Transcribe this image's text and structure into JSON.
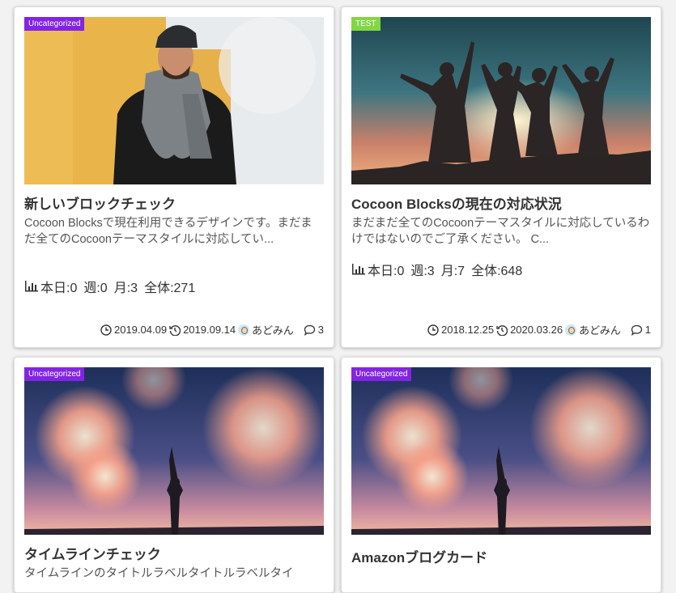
{
  "cards": [
    {
      "category": "Uncategorized",
      "category_color": "#8224e3",
      "title": "新しいブロックチェック",
      "snippet": "Cocoon Blocksで現在利用できるデザインです。まだまだ全てのCocoonテーマスタイルに対応してい...",
      "pv": {
        "today": "本日:0",
        "week": "週:0",
        "month": "月:3",
        "total": "全体:271"
      },
      "post_date": "2019.04.09",
      "update_date": "2019.09.14",
      "author": "あどみん",
      "comments": "3"
    },
    {
      "category": "TEST",
      "category_color": "#81d742",
      "title": "Cocoon Blocksの現在の対応状況",
      "snippet": "まだまだ全てのCocoonテーマスタイルに対応しているわけではないのでご了承ください。 C...",
      "pv": {
        "today": "本日:0",
        "week": "週:3",
        "month": "月:7",
        "total": "全体:648"
      },
      "post_date": "2018.12.25",
      "update_date": "2020.03.26",
      "author": "あどみん",
      "comments": "1"
    },
    {
      "category": "Uncategorized",
      "category_color": "#8224e3",
      "title": "タイムラインチェック",
      "snippet": "タイムラインのタイトルラベルタイトルラベルタイ"
    },
    {
      "category": "Uncategorized",
      "category_color": "#8224e3",
      "title": "Amazonブログカード"
    }
  ]
}
